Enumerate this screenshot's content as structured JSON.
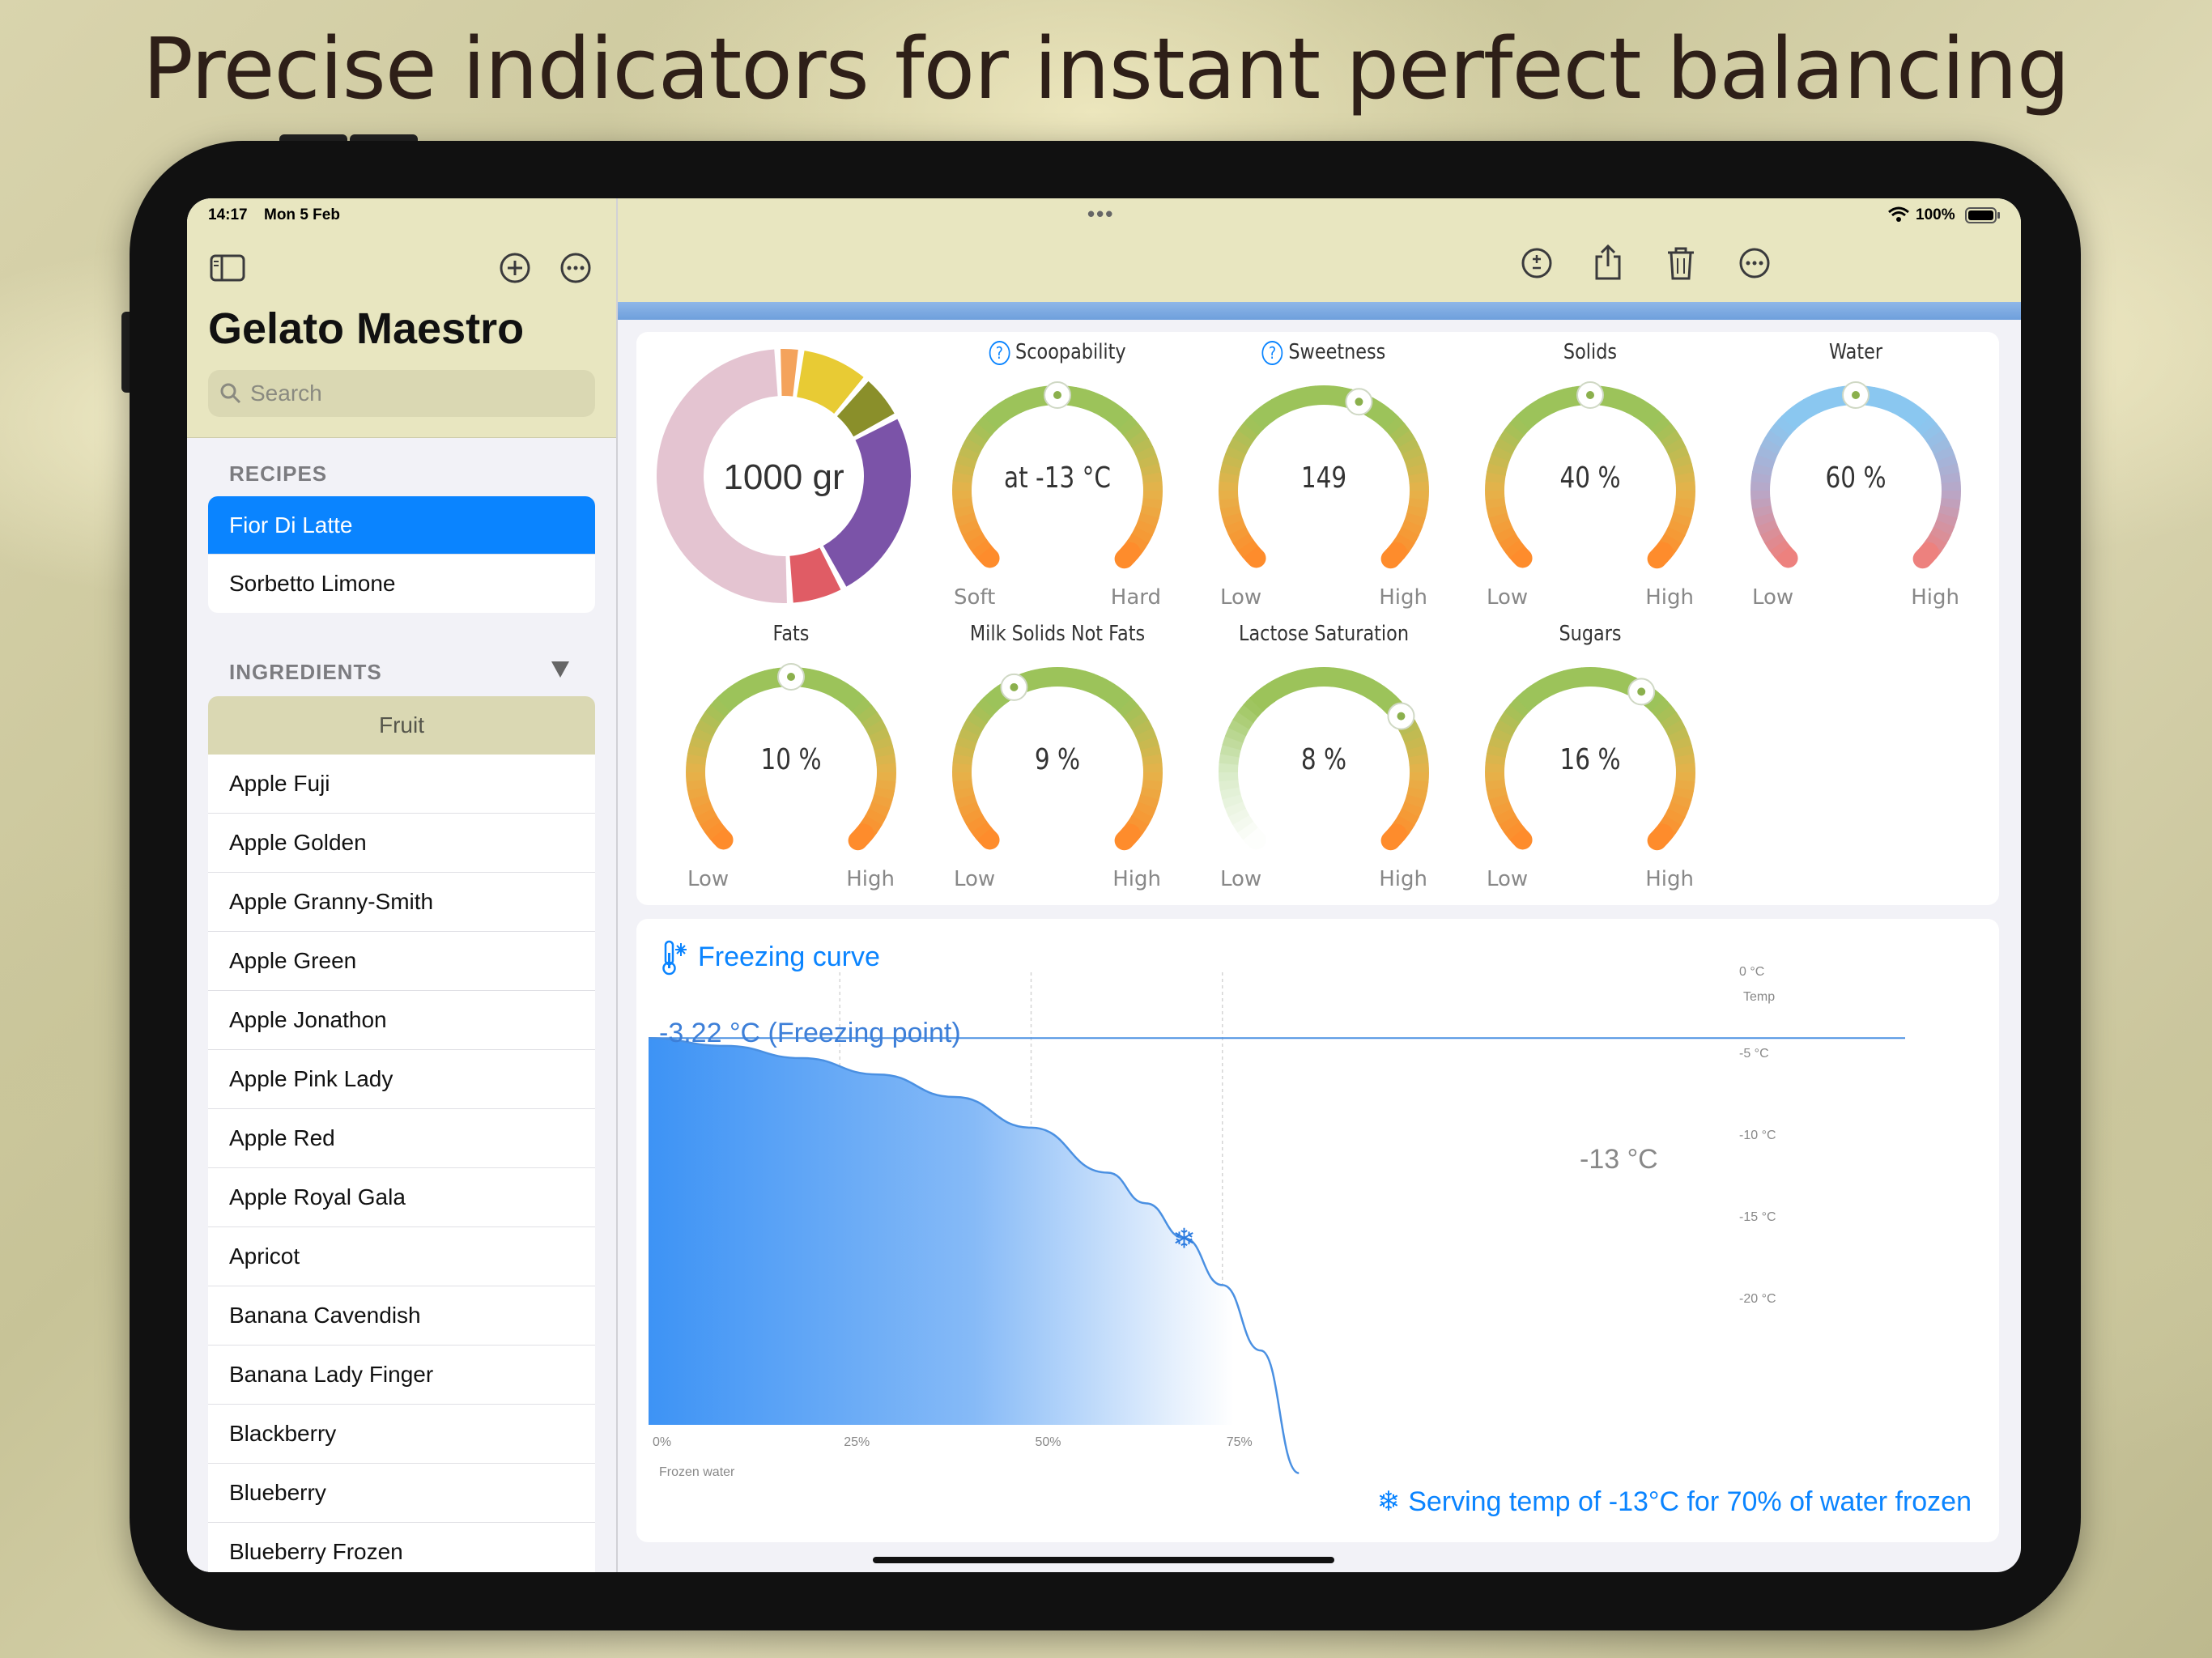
{
  "headline": "Precise indicators for instant perfect balancing",
  "status": {
    "time": "14:17",
    "date": "Mon 5 Feb",
    "battery": "100%",
    "multitask": "•••"
  },
  "sidebar": {
    "title": "Gelato Maestro",
    "search_placeholder": "Search",
    "recipes_header": "RECIPES",
    "recipes": [
      "Fior Di Latte",
      "Sorbetto Limone"
    ],
    "ingredients_header": "INGREDIENTS",
    "filter_icon": "triangle-down-icon",
    "category": "Fruit",
    "ingredients": [
      "Apple Fuji",
      "Apple Golden",
      "Apple Granny-Smith",
      "Apple Green",
      "Apple Jonathon",
      "Apple Pink Lady",
      "Apple Red",
      "Apple Royal Gala",
      "Apricot",
      "Banana Cavendish",
      "Banana Lady Finger",
      "Blackberry",
      "Blueberry",
      "Blueberry Frozen"
    ]
  },
  "toolbar": {
    "icons": [
      "sidebar-toggle-icon",
      "add-icon",
      "more-icon",
      "plus-minus-icon",
      "share-icon",
      "trash-icon",
      "more-icon"
    ]
  },
  "donut": {
    "label": "1000 gr",
    "segments": [
      {
        "color": "#f4a35c",
        "fraction": 0.03
      },
      {
        "color": "#e8cb34",
        "fraction": 0.09
      },
      {
        "color": "#8a8f2a",
        "fraction": 0.06
      },
      {
        "color": "#7b53a8",
        "fraction": 0.25
      },
      {
        "color": "#e05c65",
        "fraction": 0.07
      },
      {
        "color": "#e4c4d1",
        "fraction": 0.5
      }
    ]
  },
  "gauges_row1": [
    {
      "label": "Scoopability",
      "value": "at -13 °C",
      "low": "Soft",
      "high": "Hard",
      "help": "?",
      "level": 0.5,
      "scheme": "orange"
    },
    {
      "label": "Sweetness",
      "value": "149",
      "low": "Low",
      "high": "High",
      "help": "?",
      "level": 0.58,
      "scheme": "orange"
    },
    {
      "label": "Solids",
      "value": "40 %",
      "low": "Low",
      "high": "High",
      "level": 0.5,
      "scheme": "orange"
    },
    {
      "label": "Water",
      "value": "60 %",
      "low": "Low",
      "high": "High",
      "level": 0.5,
      "scheme": "blue"
    }
  ],
  "gauges_row2": [
    {
      "label": "Fats",
      "value": "10 %",
      "low": "Low",
      "high": "High",
      "level": 0.5,
      "scheme": "orange"
    },
    {
      "label": "Milk Solids Not Fats",
      "value": "9 %",
      "low": "Low",
      "high": "High",
      "level": 0.4,
      "scheme": "orange"
    },
    {
      "label": "Lactose Saturation",
      "value": "8 %",
      "low": "Low",
      "high": "High",
      "level": 0.7,
      "scheme": "fade"
    },
    {
      "label": "Sugars",
      "value": "16 %",
      "low": "Low",
      "high": "High",
      "level": 0.62,
      "scheme": "orange"
    }
  ],
  "freezing": {
    "title": "Freezing curve",
    "freezing_point": "-3.22 °C (Freezing point)",
    "marker_label": "-13 °C",
    "footer": "Serving temp of -13°C for 70% of water frozen",
    "y_title": "Temp",
    "y_ticks": [
      "0 °C",
      "-5 °C",
      "-10 °C",
      "-15 °C",
      "-20 °C"
    ],
    "x_ticks": [
      "0%",
      "25%",
      "50%",
      "75%"
    ],
    "x_title": "Frozen water"
  },
  "chart_data": {
    "type": "area",
    "title": "Freezing curve",
    "xlabel": "Frozen water",
    "ylabel": "Temp",
    "x": [
      0,
      10,
      20,
      30,
      40,
      50,
      60,
      65,
      70,
      75,
      80,
      85
    ],
    "y": [
      -3.22,
      -3.6,
      -4.2,
      -5.0,
      -6.1,
      -7.6,
      -9.8,
      -11.3,
      -13.0,
      -15.3,
      -18.5,
      -24.5
    ],
    "xlim": [
      0,
      100
    ],
    "ylim": [
      -25,
      0
    ],
    "annotations": [
      {
        "x": 70,
        "y": -13,
        "label": "-13 °C"
      },
      {
        "y": -3.22,
        "label": "-3.22 °C (Freezing point)"
      }
    ],
    "grid": true
  }
}
